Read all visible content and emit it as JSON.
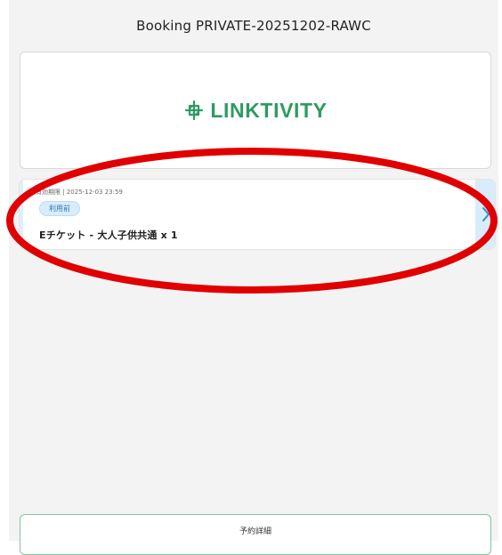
{
  "header": {
    "title": "Booking PRIVATE-20251202-RAWC"
  },
  "brand": {
    "name": "LINKTIVITY",
    "color": "#2e9b62"
  },
  "ticket": {
    "meta": "有効期限 | 2025-12-03 23:59",
    "status": "利用前",
    "title": "Eチケット - 大人子供共通 x 1"
  },
  "bottom": {
    "button_label": "予約詳細"
  },
  "icons": {
    "brand_logo": "link-knot-icon",
    "next": "chevron-right-icon"
  },
  "colors": {
    "annotation": "#e00000",
    "status_bg": "#d9ecfb",
    "status_text": "#2d77b3",
    "button_border": "#7ec6a0"
  }
}
